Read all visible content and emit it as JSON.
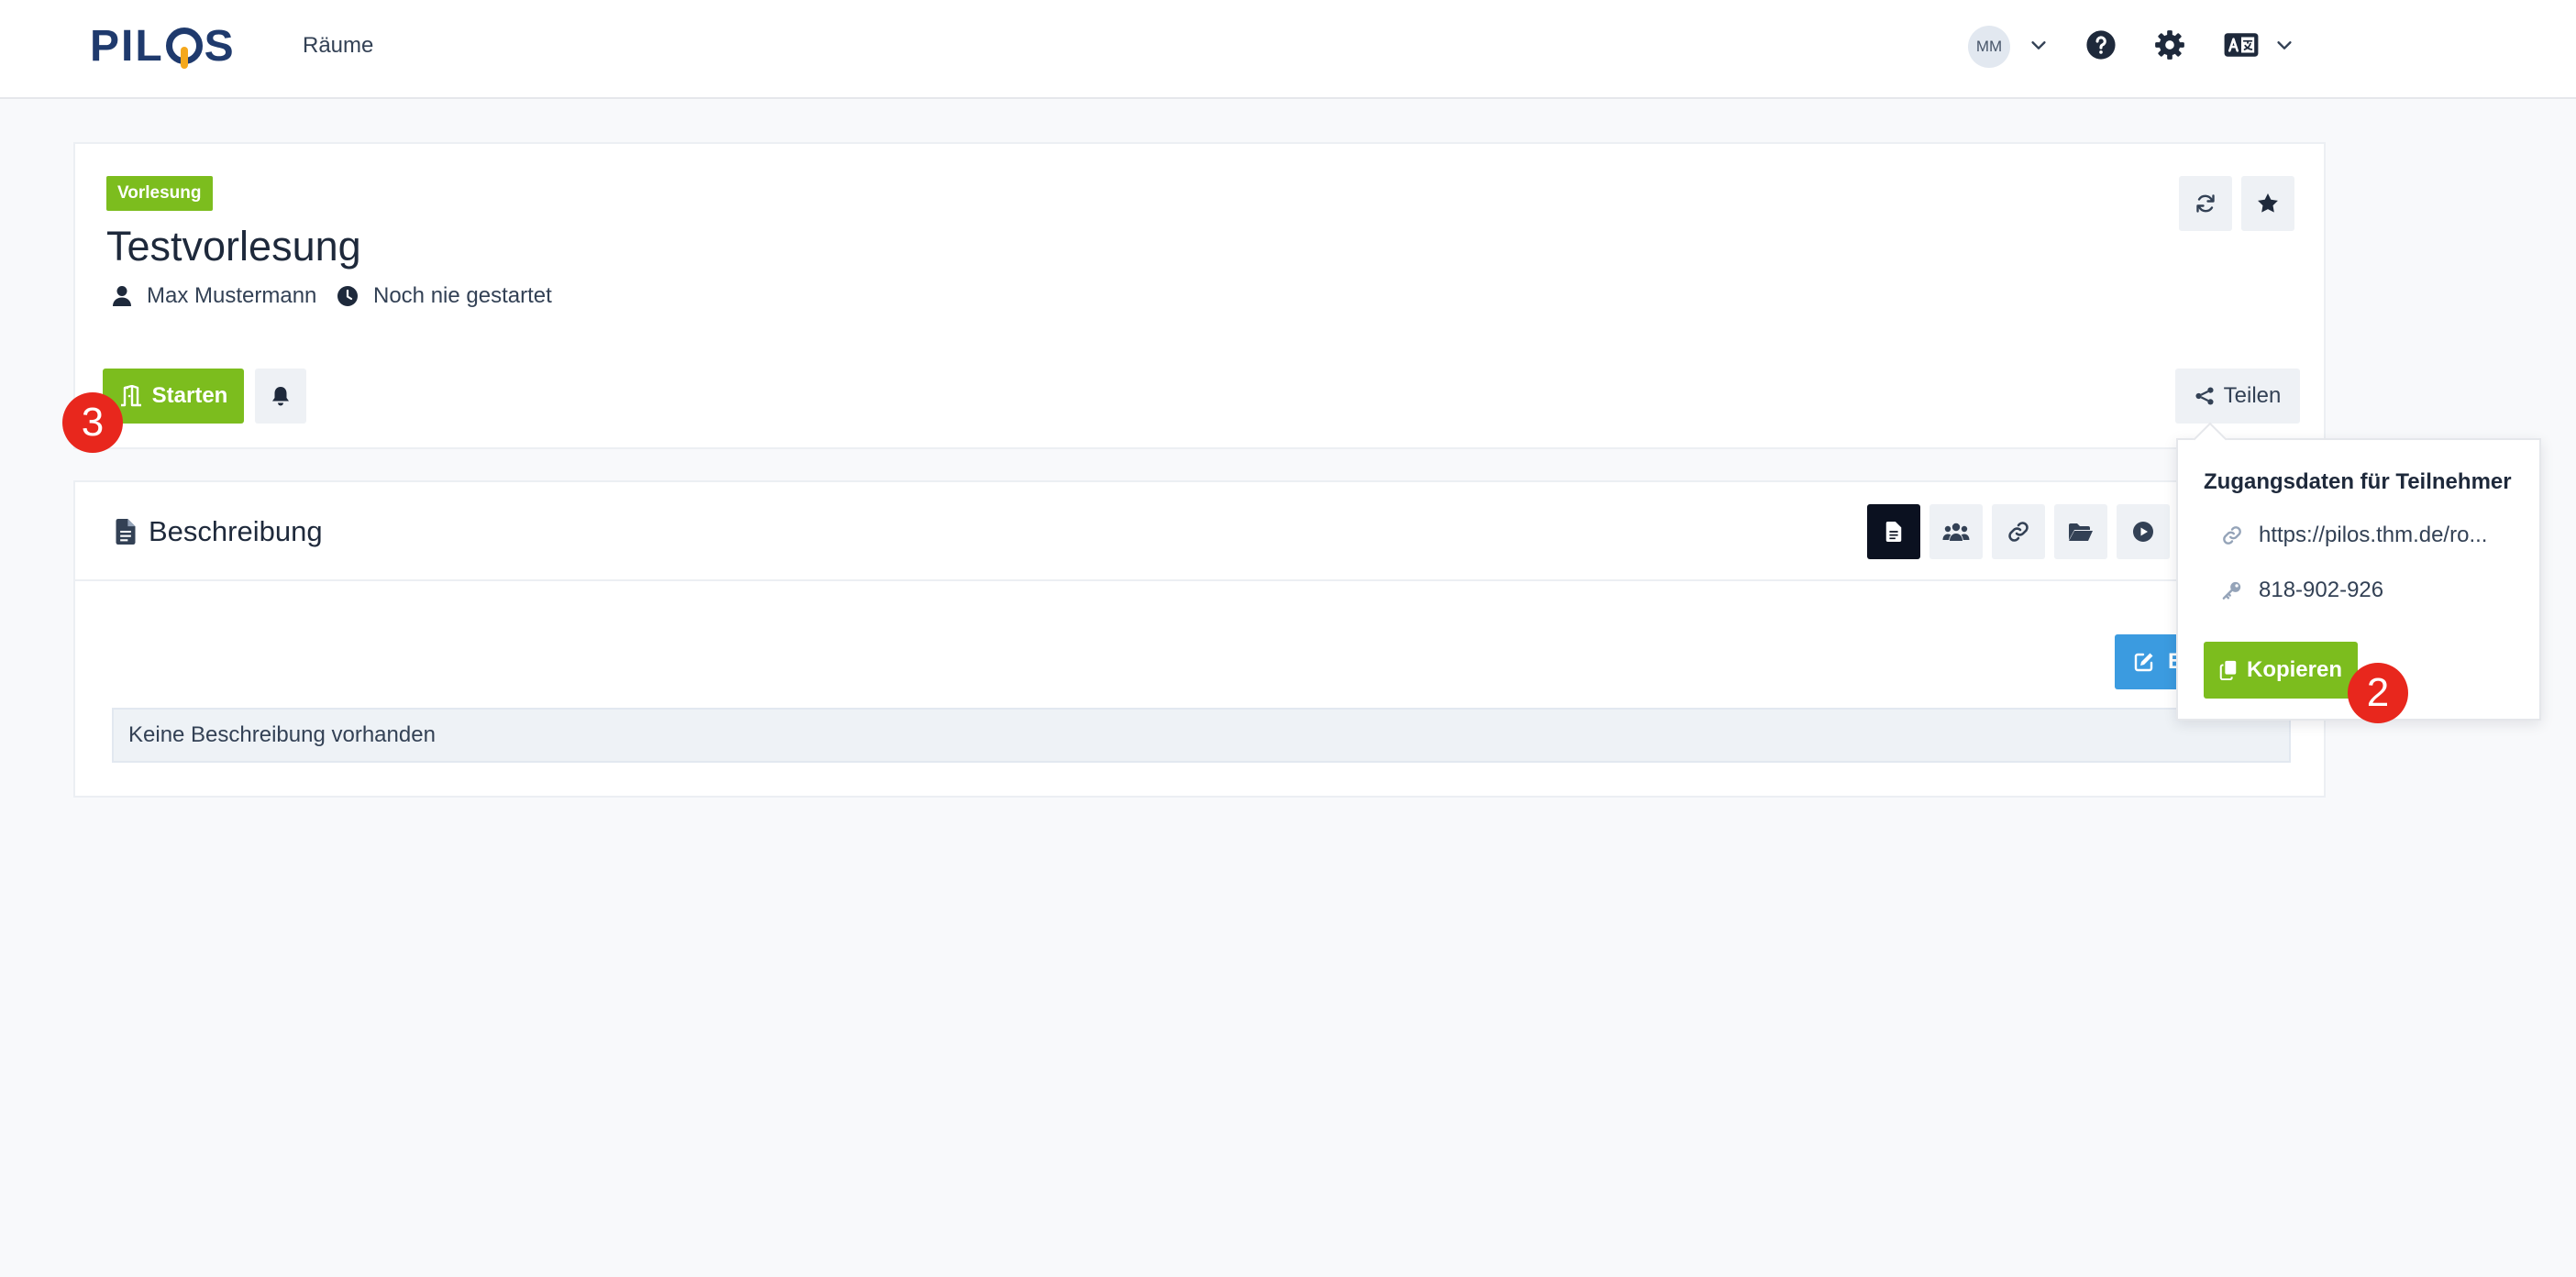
{
  "navbar": {
    "logo_text_1": "PIL",
    "logo_text_2": "S",
    "rooms_link": "Räume",
    "user_initials": "MM"
  },
  "room": {
    "type_badge": "Vorlesung",
    "title": "Testvorlesung",
    "owner": "Max Mustermann",
    "last_started": "Noch nie gestartet",
    "start_label": "Starten",
    "share_label": "Teilen"
  },
  "description": {
    "title": "Beschreibung",
    "edit_label": "B",
    "empty_message": "Keine Beschreibung vorhanden"
  },
  "share_popover": {
    "title": "Zugangsdaten für Teilnehmer",
    "url": "https://pilos.thm.de/ro...",
    "access_code": "818-902-926",
    "copy_label": "Kopieren"
  },
  "step_markers": {
    "marker_start": "3",
    "marker_copy": "2"
  },
  "colors": {
    "brand_green": "#7cbd1e",
    "edit_blue": "#3b9be0",
    "marker_red": "#e8271d",
    "logo_navy": "#1f3a6d",
    "logo_accent": "#f5a81c"
  }
}
